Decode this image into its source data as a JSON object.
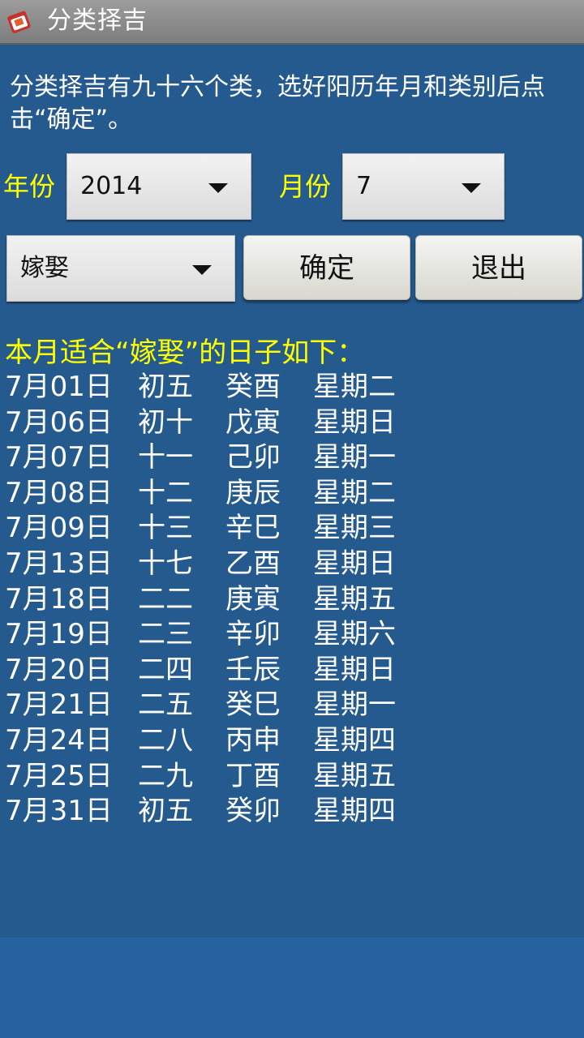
{
  "titlebar": {
    "title": "分类择吉"
  },
  "instruction": "分类择吉有九十六个类，选好阳历年月和类别后点击“确定”。",
  "form": {
    "year_label": "年份",
    "year_value": "2014",
    "month_label": "月份",
    "month_value": "7",
    "category_value": "嫁娶",
    "confirm_label": "确定",
    "exit_label": "退出"
  },
  "result": {
    "title": "本月适合“嫁娶”的日子如下：",
    "rows": [
      [
        "7月01日",
        "初五",
        "癸酉",
        "星期二"
      ],
      [
        "7月06日",
        "初十",
        "戊寅",
        "星期日"
      ],
      [
        "7月07日",
        "十一",
        "己卯",
        "星期一"
      ],
      [
        "7月08日",
        "十二",
        "庚辰",
        "星期二"
      ],
      [
        "7月09日",
        "十三",
        "辛巳",
        "星期三"
      ],
      [
        "7月13日",
        "十七",
        "乙酉",
        "星期日"
      ],
      [
        "7月18日",
        "二二",
        "庚寅",
        "星期五"
      ],
      [
        "7月19日",
        "二三",
        "辛卯",
        "星期六"
      ],
      [
        "7月20日",
        "二四",
        "壬辰",
        "星期日"
      ],
      [
        "7月21日",
        "二五",
        "癸巳",
        "星期一"
      ],
      [
        "7月24日",
        "二八",
        "丙申",
        "星期四"
      ],
      [
        "7月25日",
        "二九",
        "丁酉",
        "星期五"
      ],
      [
        "7月31日",
        "初五",
        "癸卯",
        "星期四"
      ]
    ]
  },
  "icons": {
    "app": "calendar-app-icon"
  },
  "colors": {
    "background": "#255a8f",
    "label": "#ffff00",
    "text": "#ffffff"
  }
}
